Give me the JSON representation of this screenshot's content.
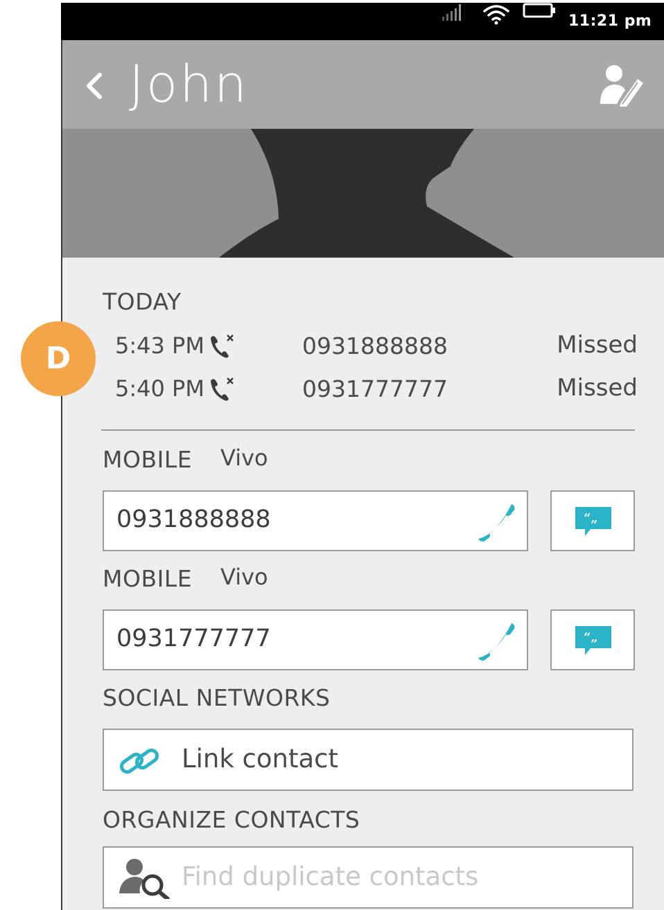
{
  "status_bar": {
    "time": "11:21 pm",
    "icons": [
      "signal-icon",
      "wifi-icon",
      "battery-icon"
    ]
  },
  "header": {
    "title": "John",
    "back_icon": "chevron-left-icon",
    "edit_icon": "edit-contact-icon"
  },
  "call_log": {
    "label": "TODAY",
    "entries": [
      {
        "time": "5:43 PM",
        "number": "0931888888",
        "status": "Missed"
      },
      {
        "time": "5:40 PM",
        "number": "0931777777",
        "status": "Missed"
      }
    ]
  },
  "phones": [
    {
      "type": "MOBILE",
      "carrier": "Vivo",
      "number": "0931888888"
    },
    {
      "type": "MOBILE",
      "carrier": "Vivo",
      "number": "0931777777"
    }
  ],
  "social": {
    "label": "SOCIAL NETWORKS",
    "link_label": "Link contact"
  },
  "organize": {
    "label": "ORGANIZE CONTACTS",
    "find_duplicates_label": "Find duplicate contacts"
  },
  "badge": {
    "letter": "D"
  },
  "colors": {
    "accent": "#2bb3c8",
    "header": "#a8a9a8",
    "badge": "#f4a547",
    "content_bg": "#eceef0"
  }
}
